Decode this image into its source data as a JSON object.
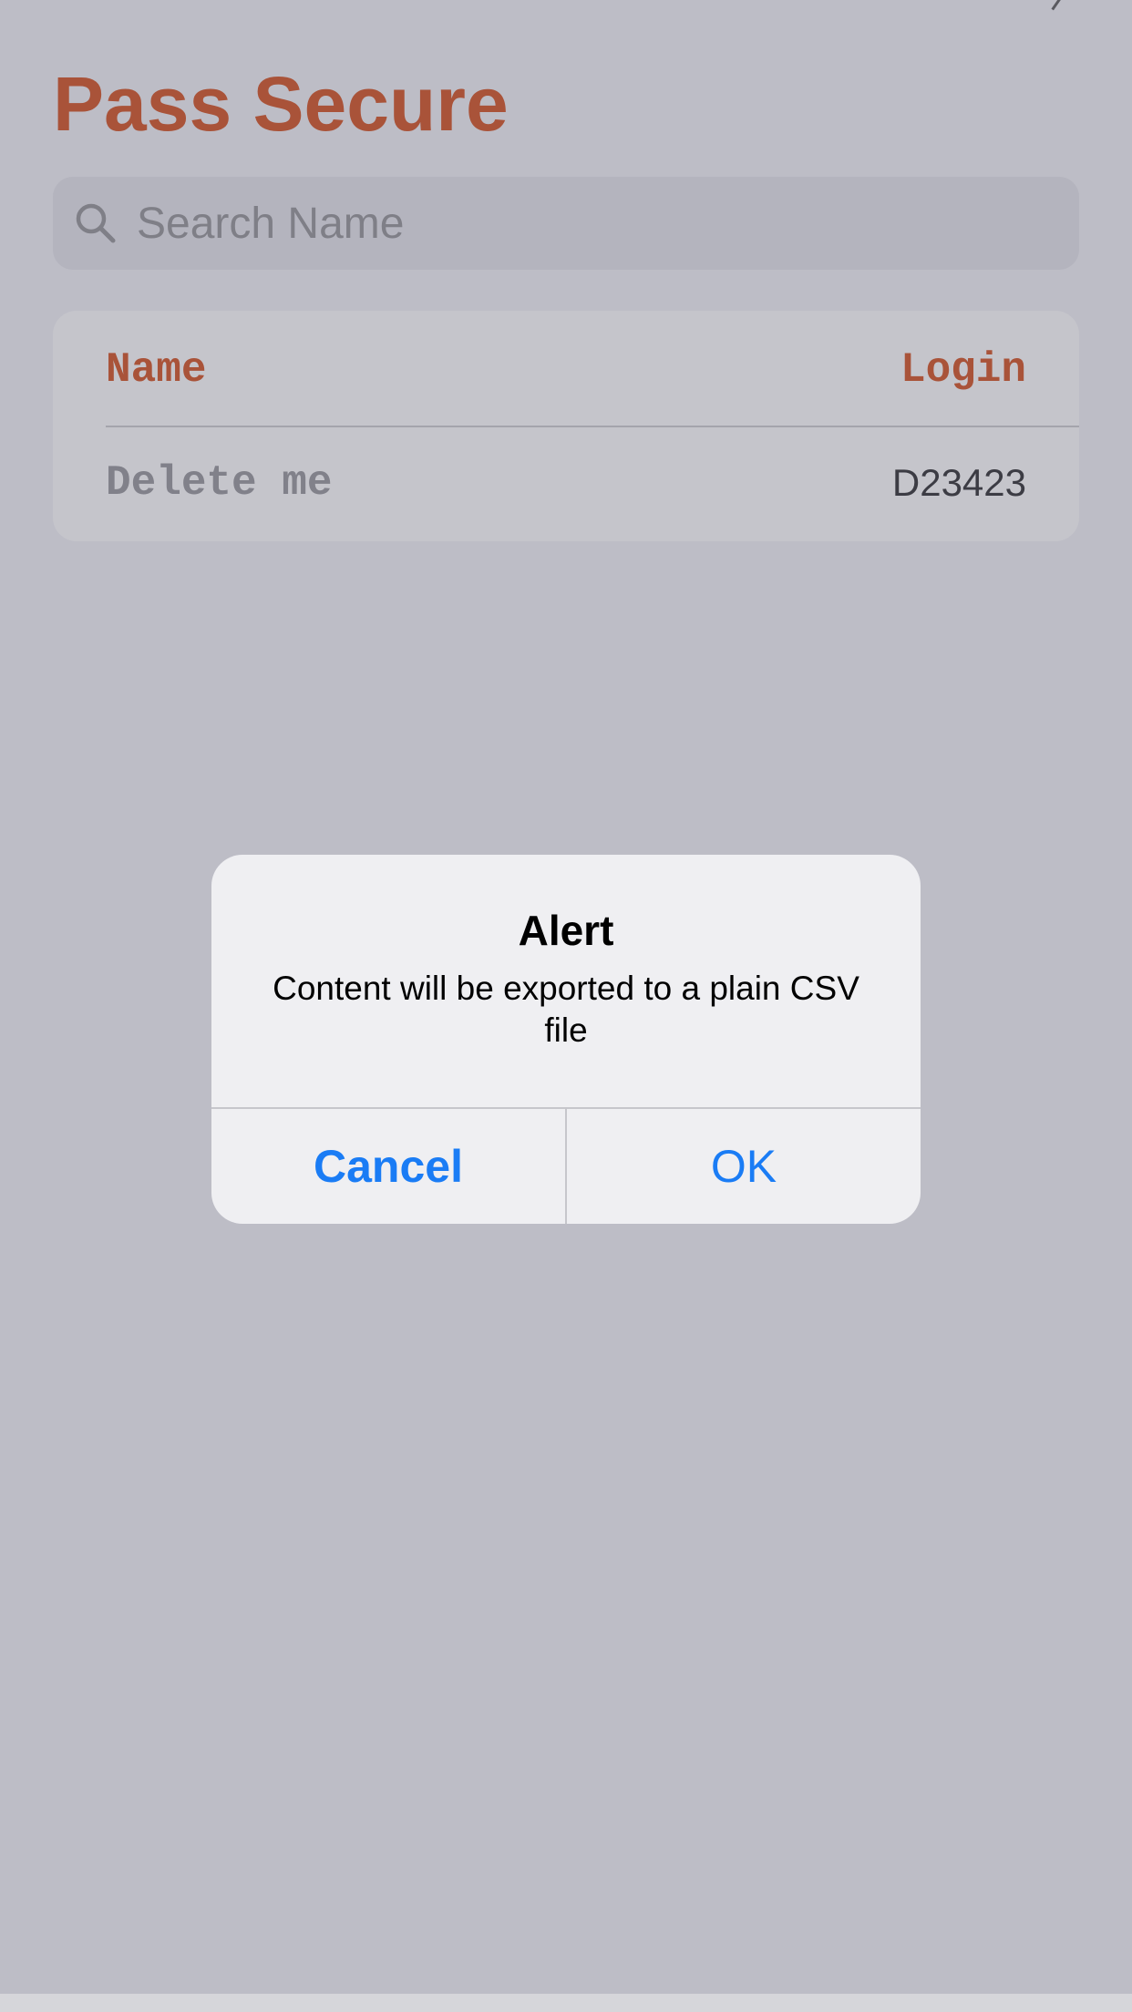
{
  "app": {
    "title": "Pass Secure"
  },
  "search": {
    "placeholder": "Search Name",
    "value": "",
    "icon": "search-icon"
  },
  "list": {
    "columns": {
      "name": "Name",
      "login": "Login"
    },
    "rows": [
      {
        "name": "Delete me",
        "login": "D23423"
      }
    ]
  },
  "alert": {
    "title": "Alert",
    "message": "Content will be exported to a plain CSV file",
    "cancel_label": "Cancel",
    "ok_label": "OK"
  },
  "colors": {
    "accent": "#d1410c",
    "link": "#1a7cf5",
    "background": "#f2f2f7"
  }
}
